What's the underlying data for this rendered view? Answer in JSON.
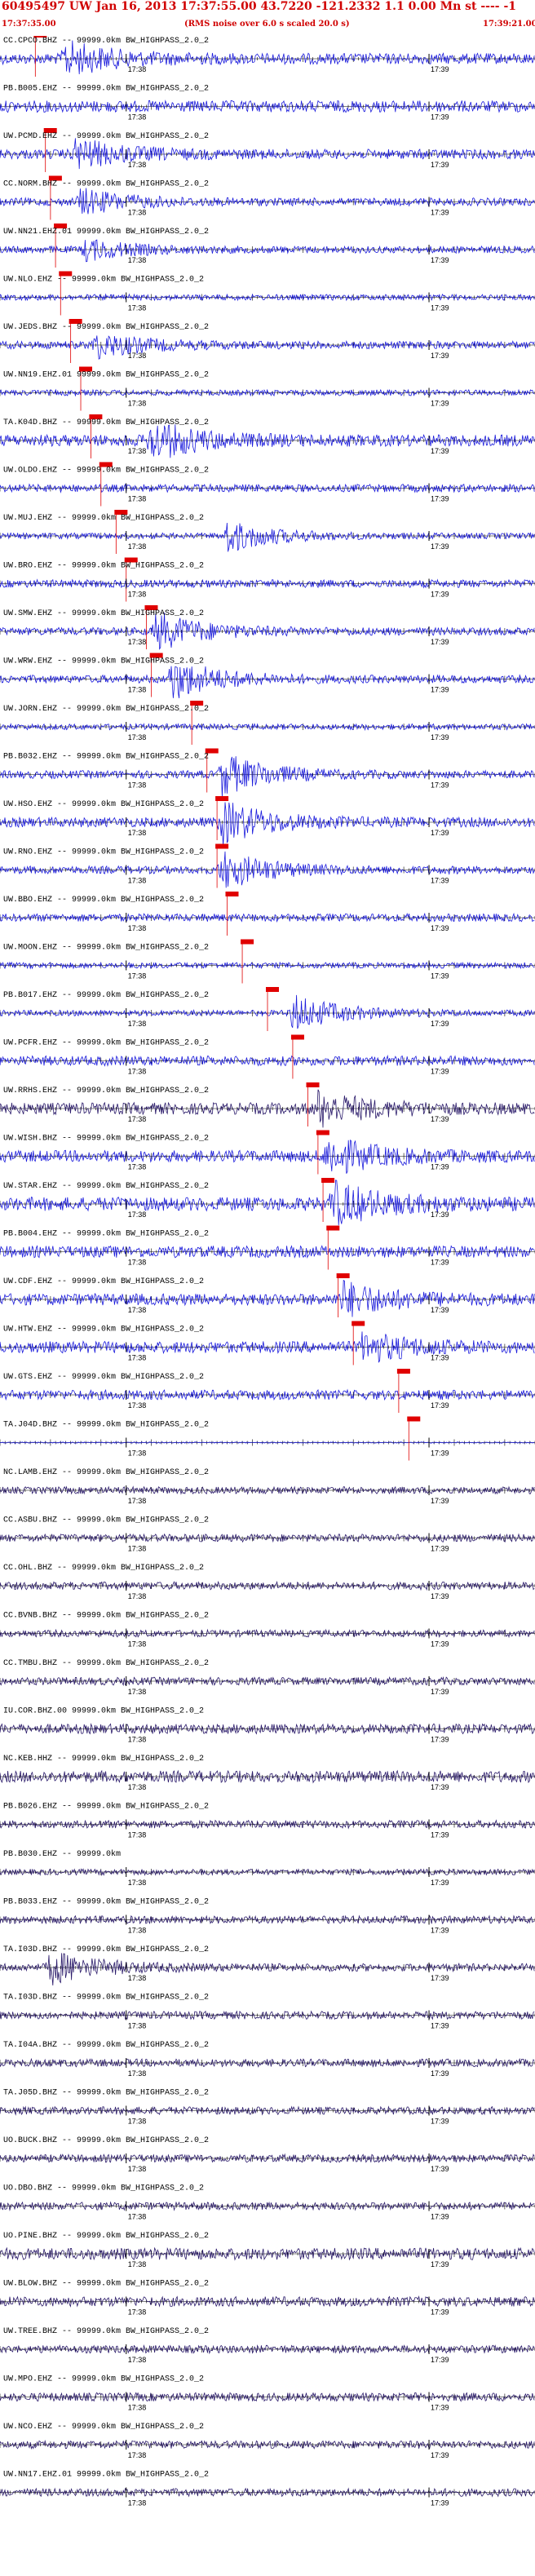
{
  "header": {
    "title": "60495497 UW Jan 16, 2013 17:37:55.00   43.7220 -121.2332  1.1 0.00 Mn st  ----  -1",
    "start_time": "17:37:35.00",
    "note": "(RMS noise over 6.0 s scaled 20.0 s)",
    "end_time": "17:39:21.00"
  },
  "chart_data": {
    "type": "line",
    "title": "60495497 UW Jan 16, 2013 17:37:55.00   43.7220 -121.2332  1.1 0.00 Mn st  ----  -1",
    "x_tick_labels": [
      "17:38",
      "17:39"
    ],
    "time_range": [
      "17:37:35",
      "17:39:21"
    ],
    "filter": "BW_HIGHPASS_2.0_2",
    "colors": {
      "header_text": "#d00000",
      "trace_active": "#1a1adc",
      "trace_quiet": "#2a1a6a",
      "pick": "#e00000",
      "tick": "#000000"
    },
    "traces": [
      {
        "label": "CC.CPCO.BHZ -- 99999.0km BW_HIGHPASS_2.0_2",
        "pick_time": "17:37:42",
        "amplitude": 0.8,
        "noise": 0.28,
        "burst_time": "17:37:48",
        "color": "active"
      },
      {
        "label": "PB.B005.EHZ -- 99999.0km BW_HIGHPASS_2.0_2",
        "pick_time": "",
        "amplitude": 0.5,
        "noise": 0.3,
        "burst_time": "",
        "color": "active"
      },
      {
        "label": "UW.PCMD.EHZ -- 99999.0km BW_HIGHPASS_2.0_2",
        "pick_time": "17:37:44",
        "amplitude": 0.7,
        "noise": 0.25,
        "burst_time": "17:37:50",
        "color": "active"
      },
      {
        "label": "CC.NORM.BHZ -- 99999.0km BW_HIGHPASS_2.0_2",
        "pick_time": "17:37:45",
        "amplitude": 0.6,
        "noise": 0.2,
        "burst_time": "17:37:51",
        "color": "active"
      },
      {
        "label": "UW.NN21.EHZ.01 99999.0km BW_HIGHPASS_2.0_2",
        "pick_time": "17:37:46",
        "amplitude": 0.5,
        "noise": 0.18,
        "burst_time": "17:37:52",
        "color": "active"
      },
      {
        "label": "UW.NLO.EHZ -- 99999.0km BW_HIGHPASS_2.0_2",
        "pick_time": "17:37:47",
        "amplitude": 0.4,
        "noise": 0.15,
        "burst_time": "",
        "color": "active"
      },
      {
        "label": "UW.JEDS.BHZ -- 99999.0km BW_HIGHPASS_2.0_2",
        "pick_time": "17:37:49",
        "amplitude": 0.6,
        "noise": 0.2,
        "burst_time": "17:37:54",
        "color": "active"
      },
      {
        "label": "UW.NN19.EHZ.01 99999.0km BW_HIGHPASS_2.0_2",
        "pick_time": "17:37:51",
        "amplitude": 0.4,
        "noise": 0.15,
        "burst_time": "",
        "color": "active"
      },
      {
        "label": "TA.K04D.BHZ -- 99999.0km BW_HIGHPASS_2.0_2",
        "pick_time": "17:37:53",
        "amplitude": 0.9,
        "noise": 0.3,
        "burst_time": "17:38:05",
        "color": "active"
      },
      {
        "label": "UW.OLDO.EHZ -- 99999.0km BW_HIGHPASS_2.0_2",
        "pick_time": "17:37:55",
        "amplitude": 0.5,
        "noise": 0.2,
        "burst_time": "",
        "color": "active"
      },
      {
        "label": "UW.MUJ.EHZ -- 99999.0km BW_HIGHPASS_2.0_2",
        "pick_time": "17:37:58",
        "amplitude": 0.8,
        "noise": 0.15,
        "burst_time": "17:38:20",
        "color": "active"
      },
      {
        "label": "UW.BRO.EHZ -- 99999.0km BW_HIGHPASS_2.0_2",
        "pick_time": "17:38:00",
        "amplitude": 0.5,
        "noise": 0.2,
        "burst_time": "",
        "color": "active"
      },
      {
        "label": "UW.SMW.EHZ -- 99999.0km BW_HIGHPASS_2.0_2",
        "pick_time": "17:38:04",
        "amplitude": 0.9,
        "noise": 0.2,
        "burst_time": "17:38:06",
        "color": "active"
      },
      {
        "label": "UW.WRW.EHZ -- 99999.0km BW_HIGHPASS_2.0_2",
        "pick_time": "17:38:05",
        "amplitude": 1.0,
        "noise": 0.2,
        "burst_time": "17:38:09",
        "color": "active"
      },
      {
        "label": "UW.JORN.EHZ -- 99999.0km BW_HIGHPASS_2.0_2",
        "pick_time": "17:38:13",
        "amplitude": 0.5,
        "noise": 0.15,
        "burst_time": "",
        "color": "active"
      },
      {
        "label": "PB.B032.EHZ -- 99999.0km BW_HIGHPASS_2.0_2",
        "pick_time": "17:38:16",
        "amplitude": 1.0,
        "noise": 0.2,
        "burst_time": "17:38:19",
        "color": "active"
      },
      {
        "label": "UW.HSO.EHZ -- 99999.0km BW_HIGHPASS_2.0_2",
        "pick_time": "17:38:18",
        "amplitude": 1.0,
        "noise": 0.25,
        "burst_time": "17:38:19",
        "color": "active"
      },
      {
        "label": "UW.RNO.EHZ -- 99999.0km BW_HIGHPASS_2.0_2",
        "pick_time": "17:38:18",
        "amplitude": 0.9,
        "noise": 0.2,
        "burst_time": "17:38:19",
        "color": "active"
      },
      {
        "label": "UW.BBO.EHZ -- 99999.0km BW_HIGHPASS_2.0_2",
        "pick_time": "17:38:20",
        "amplitude": 0.5,
        "noise": 0.2,
        "burst_time": "",
        "color": "active"
      },
      {
        "label": "UW.MOON.EHZ -- 99999.0km BW_HIGHPASS_2.0_2",
        "pick_time": "17:38:23",
        "amplitude": 0.5,
        "noise": 0.15,
        "burst_time": "",
        "color": "active"
      },
      {
        "label": "PB.B017.EHZ -- 99999.0km BW_HIGHPASS_2.0_2",
        "pick_time": "17:38:28",
        "amplitude": 0.9,
        "noise": 0.15,
        "burst_time": "17:38:33",
        "color": "active"
      },
      {
        "label": "UW.PCFR.EHZ -- 99999.0km BW_HIGHPASS_2.0_2",
        "pick_time": "17:38:33",
        "amplitude": 0.6,
        "noise": 0.25,
        "burst_time": "",
        "color": "active"
      },
      {
        "label": "UW.RRHS.EHZ -- 99999.0km BW_HIGHPASS_2.0_2",
        "pick_time": "17:38:36",
        "amplitude": 0.8,
        "noise": 0.3,
        "burst_time": "17:38:38",
        "color": "quiet"
      },
      {
        "label": "UW.WISH.BHZ -- 99999.0km BW_HIGHPASS_2.0_2",
        "pick_time": "17:38:38",
        "amplitude": 0.9,
        "noise": 0.3,
        "burst_time": "17:38:40",
        "color": "active"
      },
      {
        "label": "UW.STAR.EHZ -- 99999.0km BW_HIGHPASS_2.0_2",
        "pick_time": "17:38:39",
        "amplitude": 1.0,
        "noise": 0.35,
        "burst_time": "17:38:41",
        "color": "active"
      },
      {
        "label": "PB.B004.EHZ -- 99999.0km BW_HIGHPASS_2.0_2",
        "pick_time": "17:38:40",
        "amplitude": 0.6,
        "noise": 0.3,
        "burst_time": "",
        "color": "active"
      },
      {
        "label": "UW.CDF.EHZ -- 99999.0km BW_HIGHPASS_2.0_2",
        "pick_time": "17:38:42",
        "amplitude": 0.8,
        "noise": 0.3,
        "burst_time": "17:38:43",
        "color": "active"
      },
      {
        "label": "UW.HTW.EHZ -- 99999.0km BW_HIGHPASS_2.0_2",
        "pick_time": "17:38:45",
        "amplitude": 0.7,
        "noise": 0.3,
        "burst_time": "17:38:47",
        "color": "active"
      },
      {
        "label": "UW.GTS.EHZ -- 99999.0km BW_HIGHPASS_2.0_2",
        "pick_time": "17:38:54",
        "amplitude": 0.6,
        "noise": 0.25,
        "burst_time": "",
        "color": "active"
      },
      {
        "label": "TA.J04D.BHZ -- 99999.0km BW_HIGHPASS_2.0_2",
        "pick_time": "17:38:56",
        "amplitude": 0.2,
        "noise": 0.03,
        "burst_time": "",
        "color": "active"
      },
      {
        "label": "NC.LAMB.EHZ -- 99999.0km BW_HIGHPASS_2.0_2",
        "pick_time": "",
        "amplitude": 0.3,
        "noise": 0.18,
        "burst_time": "",
        "color": "quiet"
      },
      {
        "label": "CC.ASBU.BHZ -- 99999.0km BW_HIGHPASS_2.0_2",
        "pick_time": "",
        "amplitude": 0.3,
        "noise": 0.2,
        "burst_time": "",
        "color": "quiet"
      },
      {
        "label": "CC.OHL.BHZ -- 99999.0km BW_HIGHPASS_2.0_2",
        "pick_time": "",
        "amplitude": 0.3,
        "noise": 0.2,
        "burst_time": "",
        "color": "quiet"
      },
      {
        "label": "CC.BVNB.BHZ -- 99999.0km BW_HIGHPASS_2.0_2",
        "pick_time": "",
        "amplitude": 0.3,
        "noise": 0.18,
        "burst_time": "",
        "color": "quiet"
      },
      {
        "label": "CC.TMBU.BHZ -- 99999.0km BW_HIGHPASS_2.0_2",
        "pick_time": "",
        "amplitude": 0.3,
        "noise": 0.2,
        "burst_time": "",
        "color": "quiet"
      },
      {
        "label": "IU.COR.BHZ.00 99999.0km BW_HIGHPASS_2.0_2",
        "pick_time": "",
        "amplitude": 0.3,
        "noise": 0.25,
        "burst_time": "",
        "color": "quiet"
      },
      {
        "label": "NC.KEB.HHZ -- 99999.0km BW_HIGHPASS_2.0_2",
        "pick_time": "",
        "amplitude": 0.3,
        "noise": 0.3,
        "burst_time": "",
        "color": "quiet"
      },
      {
        "label": "PB.B026.EHZ -- 99999.0km BW_HIGHPASS_2.0_2",
        "pick_time": "",
        "amplitude": 0.3,
        "noise": 0.2,
        "burst_time": "",
        "color": "quiet"
      },
      {
        "label": "PB.B030.EHZ -- 99999.0km",
        "pick_time": "",
        "amplitude": 0.3,
        "noise": 0.15,
        "burst_time": "",
        "color": "quiet"
      },
      {
        "label": "PB.B033.EHZ -- 99999.0km BW_HIGHPASS_2.0_2",
        "pick_time": "",
        "amplitude": 0.3,
        "noise": 0.2,
        "burst_time": "",
        "color": "quiet"
      },
      {
        "label": "TA.I03D.BHZ -- 99999.0km BW_HIGHPASS_2.0_2",
        "pick_time": "",
        "amplitude": 0.8,
        "noise": 0.2,
        "burst_time": "17:37:45",
        "color": "quiet"
      },
      {
        "label": "TA.I03D.BHZ -- 99999.0km BW_HIGHPASS_2.0_2",
        "pick_time": "",
        "amplitude": 0.3,
        "noise": 0.2,
        "burst_time": "",
        "color": "quiet"
      },
      {
        "label": "TA.I04A.BHZ -- 99999.0km BW_HIGHPASS_2.0_2",
        "pick_time": "",
        "amplitude": 0.3,
        "noise": 0.2,
        "burst_time": "",
        "color": "quiet"
      },
      {
        "label": "TA.J05D.BHZ -- 99999.0km BW_HIGHPASS_2.0_2",
        "pick_time": "",
        "amplitude": 0.3,
        "noise": 0.2,
        "burst_time": "",
        "color": "quiet"
      },
      {
        "label": "UO.BUCK.BHZ -- 99999.0km BW_HIGHPASS_2.0_2",
        "pick_time": "",
        "amplitude": 0.3,
        "noise": 0.2,
        "burst_time": "",
        "color": "quiet"
      },
      {
        "label": "UO.DBO.BHZ -- 99999.0km BW_HIGHPASS_2.0_2",
        "pick_time": "",
        "amplitude": 0.3,
        "noise": 0.2,
        "burst_time": "",
        "color": "quiet"
      },
      {
        "label": "UO.PINE.BHZ -- 99999.0km BW_HIGHPASS_2.0_2",
        "pick_time": "",
        "amplitude": 0.3,
        "noise": 0.3,
        "burst_time": "",
        "color": "quiet"
      },
      {
        "label": "UW.BLOW.BHZ -- 99999.0km BW_HIGHPASS_2.0_2",
        "pick_time": "",
        "amplitude": 0.3,
        "noise": 0.25,
        "burst_time": "",
        "color": "quiet"
      },
      {
        "label": "UW.TREE.BHZ -- 99999.0km BW_HIGHPASS_2.0_2",
        "pick_time": "",
        "amplitude": 0.3,
        "noise": 0.2,
        "burst_time": "",
        "color": "quiet"
      },
      {
        "label": "UW.MPO.EHZ -- 99999.0km BW_HIGHPASS_2.0_2",
        "pick_time": "",
        "amplitude": 0.3,
        "noise": 0.22,
        "burst_time": "",
        "color": "quiet"
      },
      {
        "label": "UW.NCO.EHZ -- 99999.0km BW_HIGHPASS_2.0_2",
        "pick_time": "",
        "amplitude": 0.3,
        "noise": 0.2,
        "burst_time": "",
        "color": "quiet"
      },
      {
        "label": "UW.NN17.EHZ.01 99999.0km BW_HIGHPASS_2.0_2",
        "pick_time": "",
        "amplitude": 0.3,
        "noise": 0.2,
        "burst_time": "",
        "color": "quiet"
      }
    ]
  }
}
